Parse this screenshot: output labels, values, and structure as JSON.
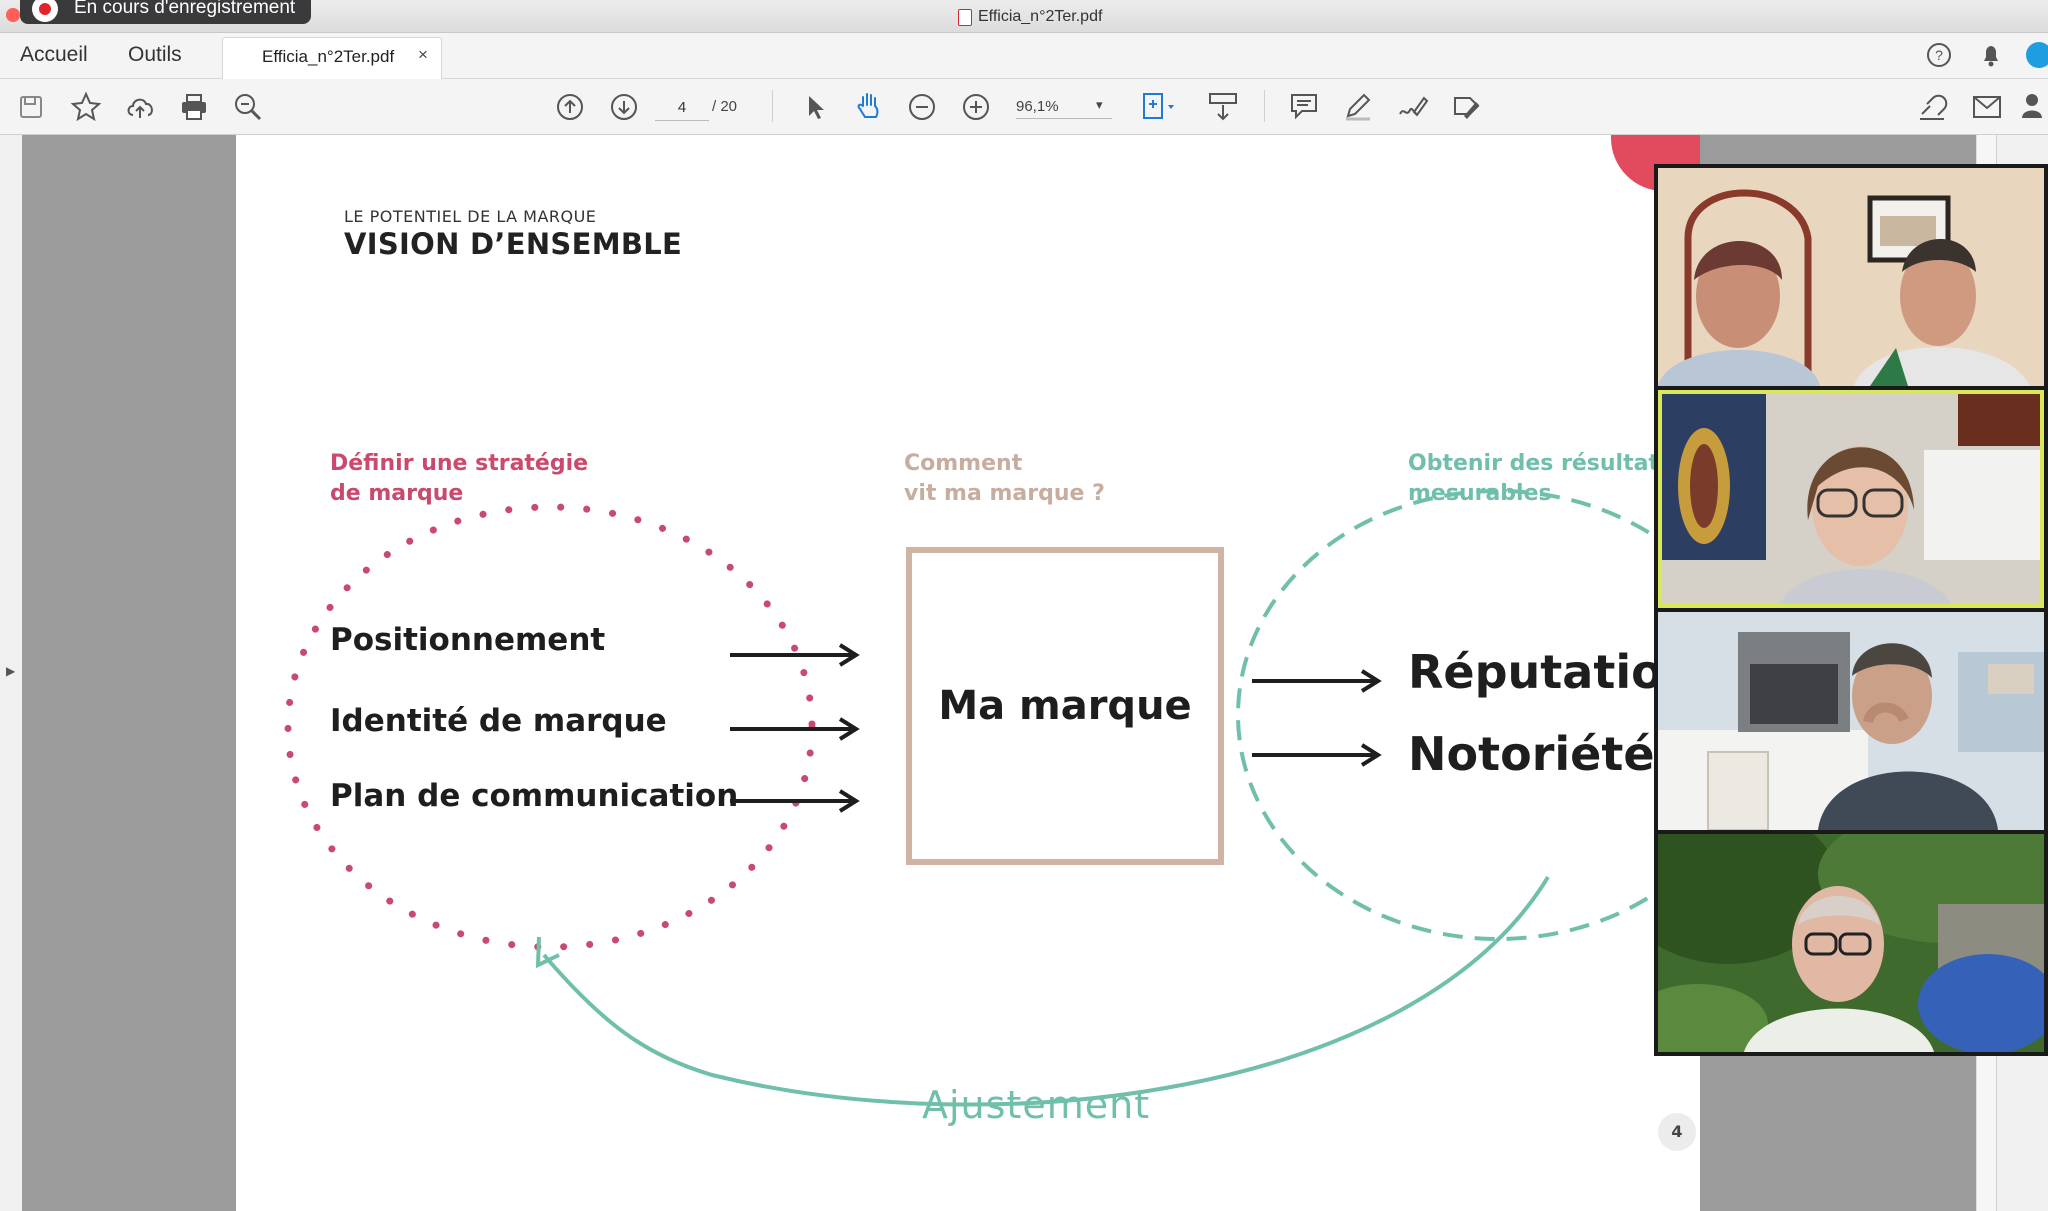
{
  "recording": {
    "label": "En cours d'enregistrement"
  },
  "window": {
    "title": "Efficia_n°2Ter.pdf"
  },
  "tabs": [
    {
      "label": "Accueil"
    },
    {
      "label": "Outils"
    }
  ],
  "document_tab": {
    "label": "Efficia_n°2Ter.pdf",
    "close": "×"
  },
  "toolbar": {
    "page_current": "4",
    "page_total": "/ 20",
    "zoom": "96,1%",
    "icons": [
      "save-icon",
      "star-icon",
      "cloud-upload-icon",
      "print-icon",
      "zoom-search-icon",
      "page-up-icon",
      "page-down-icon",
      "pointer-icon",
      "hand-icon",
      "zoom-out-icon",
      "zoom-in-icon",
      "fit-page-icon",
      "scroll-mode-icon",
      "comment-icon",
      "pen-icon",
      "sign-icon",
      "fill-sign-icon",
      "share-link-icon",
      "mail-icon",
      "share-user-icon"
    ]
  },
  "slide": {
    "kicker": "LE POTENTIEL DE LA MARQUE",
    "heading": "VISION D’ENSEMBLE",
    "col1_line1": "Définir une stratégie",
    "col1_line2": "de marque",
    "col2_line1": "Comment",
    "col2_line2": "vit ma marque ?",
    "col3_line1": "Obtenir des résultats",
    "col3_line2": "mesurables",
    "items": [
      "Positionnement",
      "Identité de marque",
      "Plan de communication"
    ],
    "center": "Ma marque",
    "results": [
      "Réputation",
      "Notoriété"
    ],
    "adjust": "Ajustement",
    "page_number": "4",
    "colors": {
      "pink": "#c94a6e",
      "beige": "#cfb3a5",
      "teal": "#6fbfab"
    }
  },
  "participants": [
    {
      "tile": "participant-1",
      "active": false
    },
    {
      "tile": "participant-2",
      "active": true
    },
    {
      "tile": "participant-3",
      "active": false
    },
    {
      "tile": "participant-4",
      "active": false
    }
  ]
}
